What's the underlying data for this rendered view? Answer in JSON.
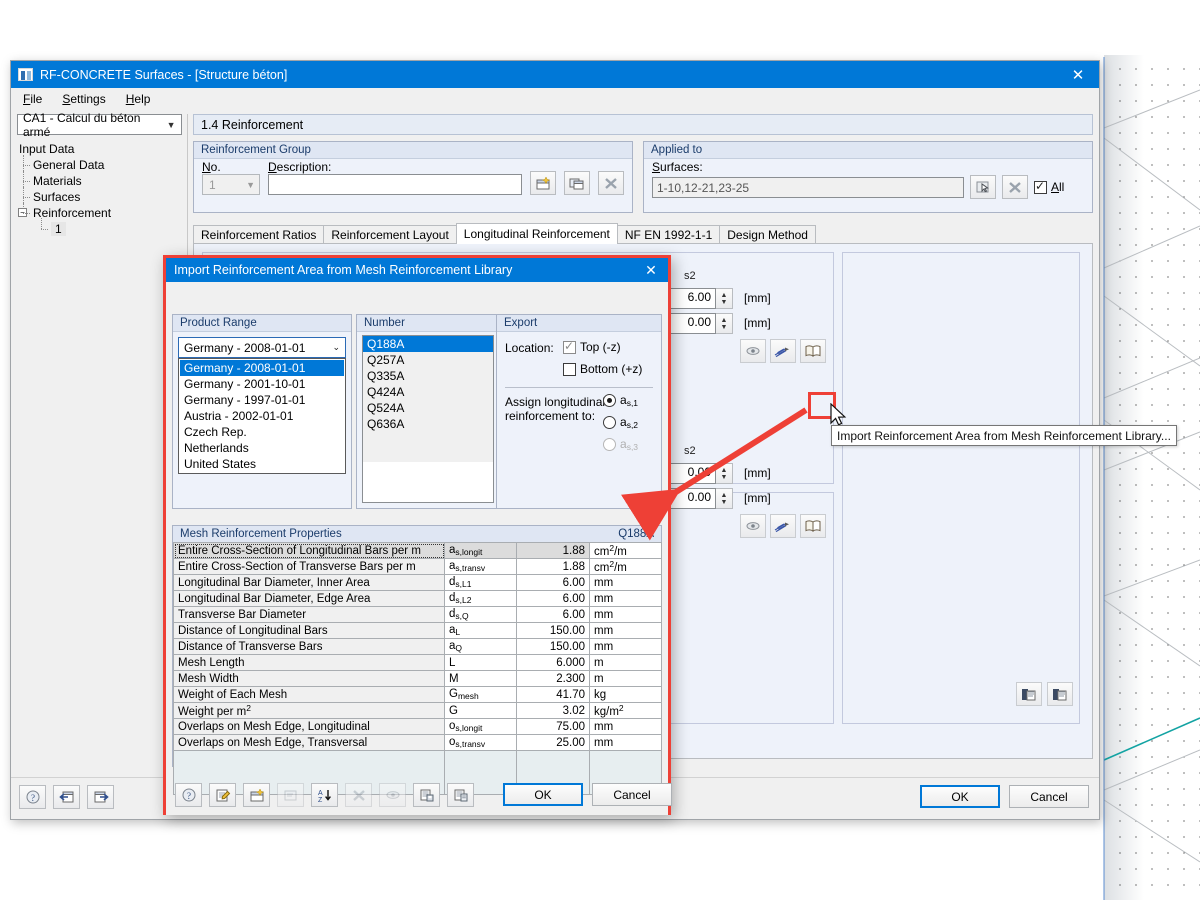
{
  "window": {
    "title": "RF-CONCRETE Surfaces - [Structure béton]",
    "close_label": "✕",
    "menu": [
      "File",
      "Settings",
      "Help"
    ],
    "nav_combo_value": "CA1 - Calcul du béton armé",
    "tree": {
      "root": "Input Data",
      "items": [
        "General Data",
        "Materials",
        "Surfaces",
        "Reinforcement"
      ],
      "sub_item": "1",
      "expander": "−"
    },
    "page_title": "1.4 Reinforcement",
    "reinforcement_group": {
      "caption": "Reinforcement Group",
      "no_label": "No.",
      "no_value": "1",
      "description_label": "Description:",
      "description_value": ""
    },
    "applied_to": {
      "caption": "Applied to",
      "surfaces_label": "Surfaces:",
      "surfaces_value": "1-10,12-21,23-25",
      "all_label": "All"
    },
    "tabs": [
      "Reinforcement Ratios",
      "Reinforcement Layout",
      "Longitudinal Reinforcement",
      "NF EN 1992-1-1",
      "Design Method"
    ],
    "active_tab": "Longitudinal Reinforcement",
    "fields": {
      "label_s2_a": "s2",
      "label_s2_b": "s2",
      "value_1": "6.00",
      "value_2": "0.00",
      "value_3": "0.00",
      "value_4": "0.00",
      "unit_mm": "[mm]"
    },
    "footer": {
      "ok_label": "OK",
      "cancel_label": "Cancel"
    }
  },
  "dialog": {
    "title": "Import Reinforcement Area from Mesh Reinforcement Library",
    "close_label": "✕",
    "product_range": {
      "caption": "Product Range",
      "selected": "Germany - 2008-01-01",
      "options": [
        "Germany - 2008-01-01",
        "Germany - 2001-10-01",
        "Germany - 1997-01-01",
        "Austria - 2002-01-01",
        "Czech Rep.",
        "Netherlands",
        "United States"
      ]
    },
    "number": {
      "caption": "Number",
      "items": [
        "Q188A",
        "Q257A",
        "Q335A",
        "Q424A",
        "Q524A",
        "Q636A"
      ],
      "selected": "Q188A"
    },
    "export": {
      "caption": "Export",
      "location_label": "Location:",
      "top_label": "Top (-z)",
      "top_checked": true,
      "bottom_label": "Bottom (+z)",
      "bottom_checked": false,
      "assign_label_line1": "Assign longitudinal",
      "assign_label_line2": "reinforcement to:",
      "radios": [
        {
          "base": "a",
          "sub": "s,1",
          "selected": true,
          "disabled": false
        },
        {
          "base": "a",
          "sub": "s,2",
          "selected": false,
          "disabled": false
        },
        {
          "base": "a",
          "sub": "s,3",
          "selected": false,
          "disabled": true
        }
      ]
    },
    "properties": {
      "caption": "Mesh Reinforcement Properties",
      "caption_right": "Q188A",
      "rows": [
        {
          "desc": "Entire Cross-Section of Longitudinal Bars per m",
          "sym_base": "a",
          "sym_sub": "s,longit",
          "value": "1.88",
          "unit_base": "cm",
          "unit_sup": "2",
          "unit_tail": "/m",
          "highlight": true
        },
        {
          "desc": "Entire Cross-Section of Transverse Bars per m",
          "sym_base": "a",
          "sym_sub": "s,transv",
          "value": "1.88",
          "unit_base": "cm",
          "unit_sup": "2",
          "unit_tail": "/m",
          "highlight": false
        },
        {
          "desc": "Longitudinal Bar Diameter, Inner Area",
          "sym_base": "d",
          "sym_sub": "s,L1",
          "value": "6.00",
          "unit_base": "mm",
          "unit_sup": "",
          "unit_tail": "",
          "highlight": false
        },
        {
          "desc": "Longitudinal Bar Diameter, Edge Area",
          "sym_base": "d",
          "sym_sub": "s,L2",
          "value": "6.00",
          "unit_base": "mm",
          "unit_sup": "",
          "unit_tail": "",
          "highlight": false
        },
        {
          "desc": "Transverse Bar Diameter",
          "sym_base": "d",
          "sym_sub": "s,Q",
          "value": "6.00",
          "unit_base": "mm",
          "unit_sup": "",
          "unit_tail": "",
          "highlight": false
        },
        {
          "desc": "Distance of Longitudinal Bars",
          "sym_base": "a",
          "sym_sub": "L",
          "value": "150.00",
          "unit_base": "mm",
          "unit_sup": "",
          "unit_tail": "",
          "highlight": false
        },
        {
          "desc": "Distance of Transverse Bars",
          "sym_base": "a",
          "sym_sub": "Q",
          "value": "150.00",
          "unit_base": "mm",
          "unit_sup": "",
          "unit_tail": "",
          "highlight": false
        },
        {
          "desc": "Mesh Length",
          "sym_base": "L",
          "sym_sub": "",
          "value": "6.000",
          "unit_base": "m",
          "unit_sup": "",
          "unit_tail": "",
          "highlight": false
        },
        {
          "desc": "Mesh Width",
          "sym_base": "M",
          "sym_sub": "",
          "value": "2.300",
          "unit_base": "m",
          "unit_sup": "",
          "unit_tail": "",
          "highlight": false
        },
        {
          "desc": "Weight of Each Mesh",
          "sym_base": "G",
          "sym_sub": "mesh",
          "value": "41.70",
          "unit_base": "kg",
          "unit_sup": "",
          "unit_tail": "",
          "highlight": false
        },
        {
          "desc": "Weight per m",
          "desc_sup": "2",
          "sym_base": "G",
          "sym_sub": "",
          "value": "3.02",
          "unit_base": "kg/m",
          "unit_sup": "2",
          "unit_tail": "",
          "highlight": false
        },
        {
          "desc": "Overlaps on Mesh Edge, Longitudinal",
          "sym_base": "o",
          "sym_sub": "s,longit",
          "value": "75.00",
          "unit_base": "mm",
          "unit_sup": "",
          "unit_tail": "",
          "highlight": false
        },
        {
          "desc": "Overlaps on Mesh Edge, Transversal",
          "sym_base": "o",
          "sym_sub": "s,transv",
          "value": "25.00",
          "unit_base": "mm",
          "unit_sup": "",
          "unit_tail": "",
          "highlight": false
        }
      ]
    },
    "footer": {
      "ok_label": "OK",
      "cancel_label": "Cancel"
    }
  },
  "tooltip": {
    "text": "Import Reinforcement Area from Mesh Reinforcement Library..."
  },
  "colors": {
    "accent": "#0078d7",
    "highlight_red": "#ee4036",
    "group_bg": "#eef2fa",
    "cad_line": "#13a3a3"
  }
}
